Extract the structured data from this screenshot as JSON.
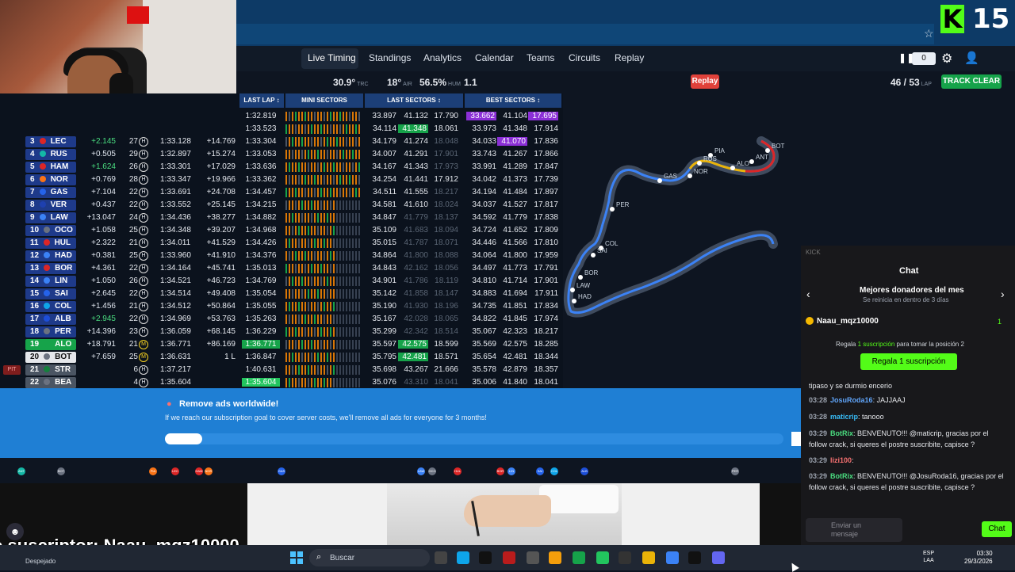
{
  "overlay": {
    "viewer_count": "15",
    "kick_logo": "K",
    "subscriber_text": "o suscriptor: Naau_mqz10000"
  },
  "nav": {
    "items": [
      "Live Timing",
      "Standings",
      "Analytics",
      "Calendar",
      "Teams",
      "Circuits",
      "Replay"
    ],
    "counter": "0"
  },
  "stats": {
    "track_temp": "30.9°",
    "track_unit": "TRC",
    "air_temp": "18°",
    "air_unit": "AIR",
    "humidity": "56.5%",
    "hum_unit": "HUM",
    "wind": "1.1",
    "replay_label": "Replay",
    "laps": "46 / 53",
    "laps_unit": "LAP",
    "track_status": "TRACK CLEAR"
  },
  "table": {
    "headers": [
      "LAST LAP ↕",
      "MINI SECTORS",
      "LAST SECTORS ↕",
      "BEST SECTORS ↕"
    ],
    "rows": [
      {
        "pos": "",
        "abbr": "",
        "gap": "",
        "laps": "",
        "tyre": "",
        "lap": "",
        "int": "",
        "last": "1:32.819",
        "s1": "33.897",
        "s2": "41.132",
        "s3": "17.790",
        "b1": "33.662",
        "b2": "41.104",
        "b3": "17.695",
        "hl": {
          "b1": "purple",
          "b3": "purple"
        }
      },
      {
        "pos": "",
        "abbr": "",
        "gap": "",
        "laps": "",
        "tyre": "",
        "lap": "",
        "int": "",
        "last": "1:33.523",
        "s1": "34.114",
        "s2": "41.348",
        "s3": "18.061",
        "b1": "33.973",
        "b2": "41.348",
        "b3": "17.914",
        "hl": {
          "s2": "green"
        }
      },
      {
        "pos": "3",
        "abbr": "LEC",
        "color": "#dc2626",
        "gap": "+2.145",
        "gapgreen": true,
        "laps": "27",
        "tyre": "H",
        "lap": "1:33.128",
        "int": "+14.769",
        "last": "1:33.304",
        "s1": "34.179",
        "s2": "41.274",
        "s3": "18.048",
        "b1": "34.033",
        "b2": "41.070",
        "b3": "17.836",
        "hl": {
          "b2": "purple"
        },
        "dim": [
          "s3"
        ]
      },
      {
        "pos": "4",
        "abbr": "RUS",
        "color": "#14b8a6",
        "gap": "+0.505",
        "laps": "29",
        "tyre": "H",
        "lap": "1:32.897",
        "int": "+15.274",
        "last": "1:33.053",
        "s1": "34.007",
        "s2": "41.291",
        "s3": "17.901",
        "b1": "33.743",
        "b2": "41.267",
        "b3": "17.866",
        "dim": [
          "s3"
        ]
      },
      {
        "pos": "5",
        "abbr": "HAM",
        "color": "#dc2626",
        "gap": "+1.624",
        "gapgreen": true,
        "laps": "26",
        "tyre": "H",
        "lap": "1:33.301",
        "int": "+17.029",
        "last": "1:33.636",
        "s1": "34.167",
        "s2": "41.343",
        "s3": "17.973",
        "b1": "33.991",
        "b2": "41.289",
        "b3": "17.847",
        "dim": [
          "s3"
        ]
      },
      {
        "pos": "6",
        "abbr": "NOR",
        "color": "#f97316",
        "gap": "+0.769",
        "laps": "28",
        "tyre": "H",
        "lap": "1:33.347",
        "int": "+19.966",
        "last": "1:33.362",
        "s1": "34.254",
        "s2": "41.441",
        "s3": "17.912",
        "b1": "34.042",
        "b2": "41.373",
        "b3": "17.739"
      },
      {
        "pos": "7",
        "abbr": "GAS",
        "color": "#2563eb",
        "gap": "+7.104",
        "laps": "22",
        "tyre": "H",
        "lap": "1:33.691",
        "int": "+24.708",
        "last": "1:34.457",
        "s1": "34.511",
        "s2": "41.555",
        "s3": "18.217",
        "b1": "34.194",
        "b2": "41.484",
        "b3": "17.897",
        "dim": [
          "s3"
        ]
      },
      {
        "pos": "8",
        "abbr": "VER",
        "color": "#1e40af",
        "gap": "+0.437",
        "laps": "22",
        "tyre": "H",
        "lap": "1:33.552",
        "int": "+25.145",
        "last": "1:34.215",
        "s1": "34.581",
        "s2": "41.610",
        "s3": "18.024",
        "b1": "34.037",
        "b2": "41.527",
        "b3": "17.817",
        "dim": [
          "s3"
        ]
      },
      {
        "pos": "9",
        "abbr": "LAW",
        "color": "#3b82f6",
        "gap": "+13.047",
        "laps": "24",
        "tyre": "H",
        "lap": "1:34.436",
        "int": "+38.277",
        "last": "1:34.882",
        "s1": "34.847",
        "s2": "41.779",
        "s3": "18.137",
        "b1": "34.592",
        "b2": "41.779",
        "b3": "17.838",
        "dim": [
          "s2",
          "s3"
        ]
      },
      {
        "pos": "10",
        "abbr": "OCO",
        "color": "#6b7280",
        "gap": "+1.058",
        "laps": "25",
        "tyre": "H",
        "lap": "1:34.348",
        "int": "+39.207",
        "last": "1:34.968",
        "s1": "35.109",
        "s2": "41.683",
        "s3": "18.094",
        "b1": "34.724",
        "b2": "41.652",
        "b3": "17.809",
        "dim": [
          "s2",
          "s3"
        ]
      },
      {
        "pos": "11",
        "abbr": "HUL",
        "color": "#dc2626",
        "gap": "+2.322",
        "laps": "21",
        "tyre": "H",
        "lap": "1:34.011",
        "int": "+41.529",
        "last": "1:34.426",
        "s1": "35.015",
        "s2": "41.787",
        "s3": "18.071",
        "b1": "34.446",
        "b2": "41.566",
        "b3": "17.810",
        "dim": [
          "s2",
          "s3"
        ]
      },
      {
        "pos": "12",
        "abbr": "HAD",
        "color": "#3b82f6",
        "gap": "+0.381",
        "laps": "25",
        "tyre": "H",
        "lap": "1:33.960",
        "int": "+41.910",
        "last": "1:34.376",
        "s1": "34.864",
        "s2": "41.800",
        "s3": "18.088",
        "b1": "34.064",
        "b2": "41.800",
        "b3": "17.959",
        "dim": [
          "s2",
          "s3"
        ]
      },
      {
        "pos": "13",
        "abbr": "BOR",
        "color": "#dc2626",
        "gap": "+4.361",
        "laps": "22",
        "tyre": "H",
        "lap": "1:34.164",
        "int": "+45.741",
        "last": "1:35.013",
        "s1": "34.843",
        "s2": "42.162",
        "s3": "18.056",
        "b1": "34.497",
        "b2": "41.773",
        "b3": "17.791",
        "dim": [
          "s2",
          "s3"
        ]
      },
      {
        "pos": "14",
        "abbr": "LIN",
        "color": "#3b82f6",
        "gap": "+1.050",
        "laps": "26",
        "tyre": "H",
        "lap": "1:34.521",
        "int": "+46.723",
        "last": "1:34.769",
        "s1": "34.901",
        "s2": "41.786",
        "s3": "18.119",
        "b1": "34.810",
        "b2": "41.714",
        "b3": "17.901",
        "dim": [
          "s2",
          "s3"
        ]
      },
      {
        "pos": "15",
        "abbr": "SAI",
        "color": "#2563eb",
        "gap": "+2.645",
        "laps": "22",
        "tyre": "H",
        "lap": "1:34.514",
        "int": "+49.408",
        "last": "1:35.054",
        "s1": "35.142",
        "s2": "41.858",
        "s3": "18.147",
        "b1": "34.883",
        "b2": "41.694",
        "b3": "17.911",
        "dim": [
          "s2",
          "s3"
        ]
      },
      {
        "pos": "16",
        "abbr": "COL",
        "color": "#0ea5e9",
        "gap": "+1.456",
        "laps": "21",
        "tyre": "H",
        "lap": "1:34.512",
        "int": "+50.864",
        "last": "1:35.055",
        "s1": "35.190",
        "s2": "41.930",
        "s3": "18.196",
        "b1": "34.735",
        "b2": "41.851",
        "b3": "17.834",
        "dim": [
          "s2",
          "s3"
        ]
      },
      {
        "pos": "17",
        "abbr": "ALB",
        "color": "#1d4ed8",
        "gap": "+2.945",
        "gapgreen": true,
        "laps": "22",
        "tyre": "H",
        "lap": "1:34.969",
        "int": "+53.763",
        "last": "1:35.263",
        "s1": "35.167",
        "s2": "42.028",
        "s3": "18.065",
        "b1": "34.822",
        "b2": "41.845",
        "b3": "17.974",
        "dim": [
          "s2",
          "s3"
        ]
      },
      {
        "pos": "18",
        "abbr": "PER",
        "color": "#6b7280",
        "gap": "+14.396",
        "laps": "23",
        "tyre": "H",
        "lap": "1:36.059",
        "int": "+68.145",
        "last": "1:36.229",
        "s1": "35.299",
        "s2": "42.342",
        "s3": "18.514",
        "b1": "35.067",
        "b2": "42.323",
        "b3": "18.217",
        "dim": [
          "s2",
          "s3"
        ]
      },
      {
        "pos": "19",
        "abbr": "ALO",
        "color": "#16a34a",
        "gap": "+18.791",
        "laps": "21",
        "tyre": "M",
        "lap": "1:36.771",
        "int": "+86.169",
        "last": "1:36.771",
        "s1": "35.597",
        "s2": "42.575",
        "s3": "18.599",
        "b1": "35.569",
        "b2": "42.575",
        "b3": "18.285",
        "hl": {
          "last": "green",
          "s2": "green"
        },
        "posbg": "#16a34a"
      },
      {
        "pos": "20",
        "abbr": "BOT",
        "color": "#6b7280",
        "gap": "+7.659",
        "laps": "25",
        "tyre": "M",
        "lap": "1:36.631",
        "int": "1 L",
        "last": "1:36.847",
        "s1": "35.795",
        "s2": "42.481",
        "s3": "18.571",
        "b1": "35.654",
        "b2": "42.481",
        "b3": "18.344",
        "hl": {
          "s2": "green"
        },
        "posbg": "#e5e7eb",
        "postext": "#111"
      },
      {
        "pos": "21",
        "abbr": "STR",
        "color": "#15803d",
        "gap": "",
        "laps": "6",
        "tyre": "H",
        "lap": "1:37.217",
        "int": "",
        "last": "1:40.631",
        "s1": "35.698",
        "s2": "43.267",
        "s3": "21.666",
        "b1": "35.578",
        "b2": "42.879",
        "b3": "18.357",
        "pit": "PIT",
        "posbg": "#4b5563"
      },
      {
        "pos": "22",
        "abbr": "BEA",
        "color": "#6b7280",
        "gap": "",
        "laps": "4",
        "tyre": "H",
        "lap": "1:35.604",
        "int": "",
        "last": "1:35.604",
        "s1": "35.076",
        "s2": "43.310",
        "s3": "18.041",
        "b1": "35.006",
        "b2": "41.840",
        "b3": "18.041",
        "hl": {
          "last": "greenbg"
        },
        "dim": [
          "s2",
          "s3"
        ],
        "posbg": "#4b5563"
      }
    ]
  },
  "track": {
    "labels": [
      "BOT",
      "ANT",
      "ALO",
      "PIA",
      "RUS",
      "NOR",
      "GAS",
      "PER",
      "COL",
      "SAI",
      "BOR",
      "LAW",
      "HAD"
    ]
  },
  "banner": {
    "title": "Remove ads worldwide!",
    "text": "If we reach our subscription goal to cover server costs, we'll remove all ads for everyone for 3 months!",
    "progress": 0.06
  },
  "strip": {
    "chips": [
      "ANT",
      "BOT",
      "PIA",
      "LEC",
      "HAM",
      "NOR",
      "GAS",
      "LAW",
      "OCO",
      "HUL",
      "BOR",
      "LIN",
      "SAI",
      "COL",
      "ALB",
      "PER"
    ]
  },
  "chat": {
    "kick_label": "KICK",
    "title": "Chat",
    "donors_title": "Mejores donadores del mes",
    "donors_sub": "Se reinicia en dentro de 3 días",
    "top_donor": "Naau_mqz10000",
    "donor_rank": "1",
    "gift_text_a": "Regala",
    "gift_text_b": "1 suscripción",
    "gift_text_c": "para tomar la posición 2",
    "gift_button": "Regala 1 suscripción",
    "messages": [
      {
        "time": "",
        "user": "",
        "text": "tipaso y se durmio encerio",
        "color": "#e5e7eb"
      },
      {
        "time": "03:28",
        "user": "JosuRoda16",
        "text": ": JAJJAAJ",
        "color": "#60a5fa"
      },
      {
        "time": "03:28",
        "user": "maticrip",
        "text": ": tanooo",
        "color": "#38bdf8"
      },
      {
        "time": "03:29",
        "user": "BotRix",
        "text": ": BENVENUTO!!! @maticrip, gracias por el follow crack, si queres el postre suscribite, capisce ?",
        "color": "#4ade80"
      },
      {
        "time": "03:29",
        "user": "lizi100",
        "text": ":",
        "color": "#f87171"
      },
      {
        "time": "03:29",
        "user": "BotRix",
        "text": ": BENVENUTO!!! @JosuRoda16, gracias por el follow crack, si queres el postre suscribite, capisce ?",
        "color": "#4ade80"
      }
    ],
    "input_placeholder": "Enviar un mensaje",
    "send_label": "Chat"
  },
  "taskbar": {
    "weather": "Despejado",
    "search_placeholder": "Buscar",
    "lang_line1": "ESP",
    "lang_line2": "LAA",
    "time": "03:30",
    "date": "29/3/2026"
  }
}
